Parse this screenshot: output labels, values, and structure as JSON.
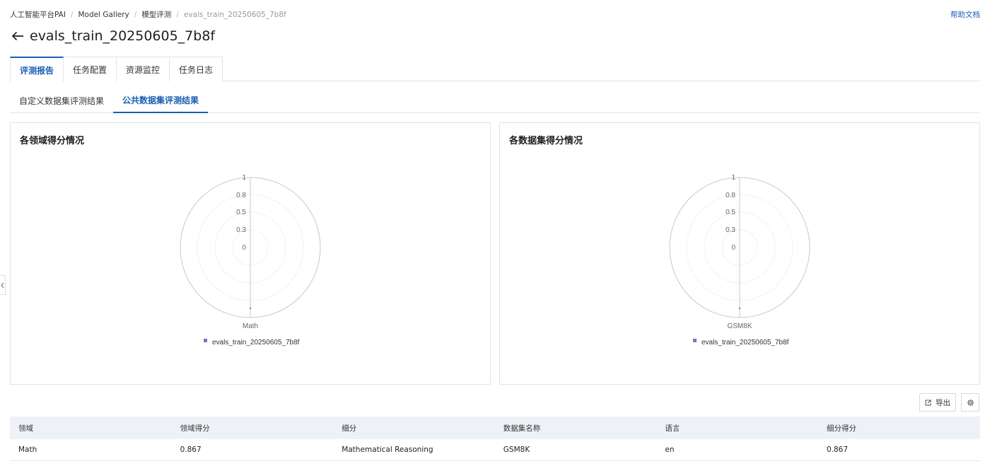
{
  "breadcrumb": {
    "items": [
      "人工智能平台PAI",
      "Model Gallery",
      "模型评测"
    ],
    "current": "evals_train_20250605_7b8f"
  },
  "help_link": "帮助文档",
  "page_title": "evals_train_20250605_7b8f",
  "main_tabs": [
    {
      "label": "评测报告",
      "active": true
    },
    {
      "label": "任务配置",
      "active": false
    },
    {
      "label": "资源监控",
      "active": false
    },
    {
      "label": "任务日志",
      "active": false
    }
  ],
  "sub_tabs": [
    {
      "label": "自定义数据集评测结果",
      "active": false
    },
    {
      "label": "公共数据集评测结果",
      "active": true
    }
  ],
  "charts": {
    "domain": {
      "title": "各领域得分情况",
      "ticks": [
        "1",
        "0.8",
        "0.5",
        "0.3",
        "0"
      ],
      "axis_label": "Math",
      "legend": "evals_train_20250605_7b8f"
    },
    "dataset": {
      "title": "各数据集得分情况",
      "ticks": [
        "1",
        "0.8",
        "0.5",
        "0.3",
        "0"
      ],
      "axis_label": "GSM8K",
      "legend": "evals_train_20250605_7b8f"
    }
  },
  "chart_data": [
    {
      "type": "radar",
      "title": "各领域得分情况",
      "categories": [
        "Math"
      ],
      "series": [
        {
          "name": "evals_train_20250605_7b8f",
          "values": [
            0.867
          ]
        }
      ],
      "rlim": [
        0,
        1
      ],
      "ticks": [
        0,
        0.3,
        0.5,
        0.8,
        1
      ],
      "legend": "bottom-center",
      "color": "#7b6fd6"
    },
    {
      "type": "radar",
      "title": "各数据集得分情况",
      "categories": [
        "GSM8K"
      ],
      "series": [
        {
          "name": "evals_train_20250605_7b8f",
          "values": [
            0.867
          ]
        }
      ],
      "rlim": [
        0,
        1
      ],
      "ticks": [
        0,
        0.3,
        0.5,
        0.8,
        1
      ],
      "legend": "bottom-center",
      "color": "#7b6fd6"
    }
  ],
  "toolbar": {
    "export_label": "导出"
  },
  "table": {
    "columns": [
      "领域",
      "领域得分",
      "细分",
      "数据集名称",
      "语言",
      "细分得分"
    ],
    "rows": [
      [
        "Math",
        "0.867",
        "Mathematical Reasoning",
        "GSM8K",
        "en",
        "0.867"
      ]
    ]
  },
  "colors": {
    "accent": "#1b5fb5",
    "series": "#7b6fd6",
    "table_header_bg": "#eef1f6"
  }
}
